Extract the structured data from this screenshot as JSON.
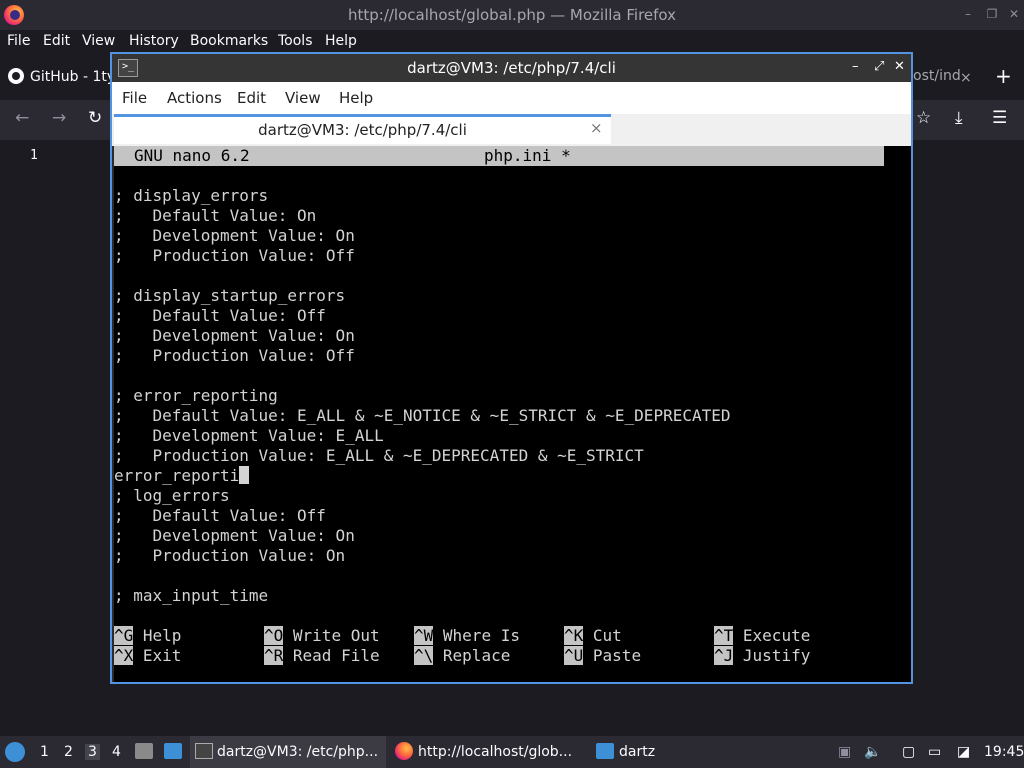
{
  "firefox": {
    "title": "http://localhost/global.php — Mozilla Firefox",
    "menu": [
      "File",
      "Edit",
      "View",
      "History",
      "Bookmarks",
      "Tools",
      "Help"
    ],
    "tab_github": "GitHub - 1ty",
    "tab_right": "ost/ind",
    "tab_close": "×",
    "new_tab": "+",
    "line_number": "1"
  },
  "terminal": {
    "title": "dartz@VM3: /etc/php/7.4/cli",
    "menu": [
      "File",
      "Actions",
      "Edit",
      "View",
      "Help"
    ],
    "tab_label": "dartz@VM3: /etc/php/7.4/cli",
    "tab_close": "×"
  },
  "nano": {
    "version": "GNU nano 6.2",
    "filename": "php.ini *",
    "lines": [
      "",
      "; display_errors",
      ";   Default Value: On",
      ";   Development Value: On",
      ";   Production Value: Off",
      "",
      "; display_startup_errors",
      ";   Default Value: Off",
      ";   Development Value: On",
      ";   Production Value: Off",
      "",
      "; error_reporting",
      ";   Default Value: E_ALL & ~E_NOTICE & ~E_STRICT & ~E_DEPRECATED",
      ";   Development Value: E_ALL",
      ";   Production Value: E_ALL & ~E_DEPRECATED & ~E_STRICT",
      "error_reporti",
      "; log_errors",
      ";   Default Value: Off",
      ";   Development Value: On",
      ";   Production Value: On",
      "",
      "; max_input_time"
    ],
    "shortcuts_row1": [
      {
        "key": "^G",
        "label": "Help"
      },
      {
        "key": "^O",
        "label": "Write Out"
      },
      {
        "key": "^W",
        "label": "Where Is"
      },
      {
        "key": "^K",
        "label": "Cut"
      },
      {
        "key": "^T",
        "label": "Execute"
      }
    ],
    "shortcuts_row2": [
      {
        "key": "^X",
        "label": "Exit"
      },
      {
        "key": "^R",
        "label": "Read File"
      },
      {
        "key": "^\\",
        "label": "Replace"
      },
      {
        "key": "^U",
        "label": "Paste"
      },
      {
        "key": "^J",
        "label": "Justify"
      }
    ]
  },
  "taskbar": {
    "workspaces": [
      "1",
      "2",
      "3",
      "4"
    ],
    "tasks": [
      "dartz@VM3: /etc/php...",
      "http://localhost/glob...",
      "dartz"
    ],
    "clock": "19:45"
  }
}
